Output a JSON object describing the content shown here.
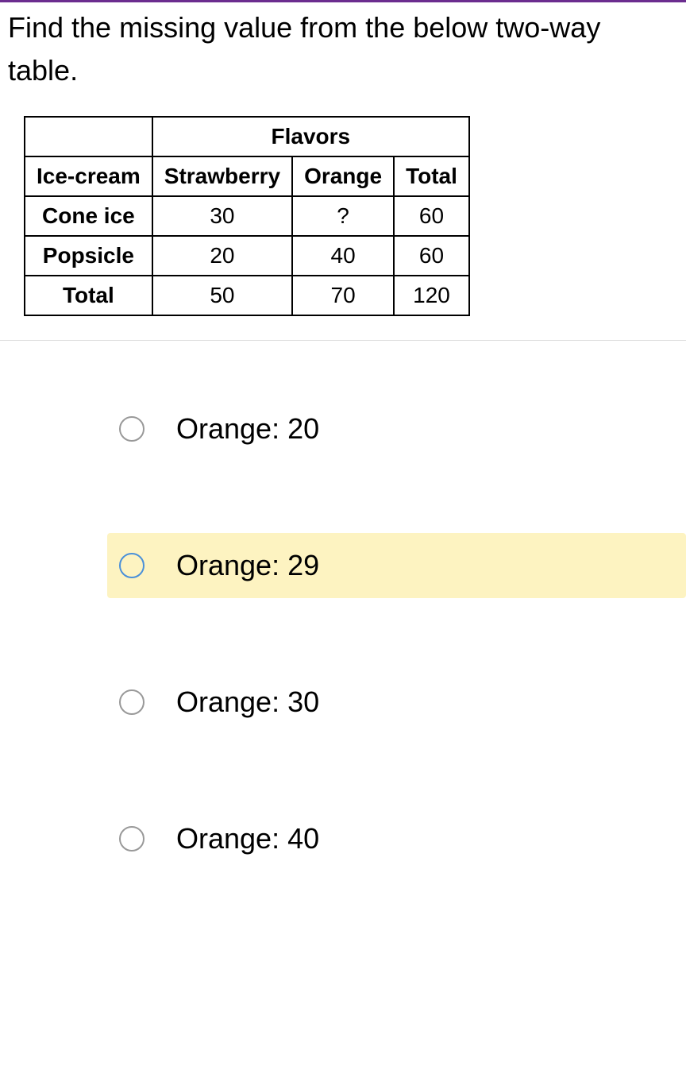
{
  "question": "Find the missing value from the below two-way table.",
  "table": {
    "flavorsHeader": "Flavors",
    "rowHeaders": {
      "iceCream": "Ice-cream",
      "strawberry": "Strawberry",
      "orange": "Orange",
      "total": "Total",
      "coneIce": "Cone ice",
      "popsicle": "Popsicle",
      "totalRow": "Total"
    },
    "cells": {
      "coneStrawberry": "30",
      "coneOrange": "?",
      "coneTotal": "60",
      "popStrawberry": "20",
      "popOrange": "40",
      "popTotal": "60",
      "totStrawberry": "50",
      "totOrange": "70",
      "totTotal": "120"
    }
  },
  "options": [
    {
      "label": "Orange: 20",
      "highlighted": false
    },
    {
      "label": "Orange: 29",
      "highlighted": true
    },
    {
      "label": "Orange: 30",
      "highlighted": false
    },
    {
      "label": "Orange: 40",
      "highlighted": false
    }
  ],
  "chart_data": {
    "type": "table",
    "title": "Flavors two-way table",
    "row_labels": [
      "Cone ice",
      "Popsicle",
      "Total"
    ],
    "col_labels": [
      "Strawberry",
      "Orange",
      "Total"
    ],
    "values": [
      [
        30,
        "?",
        60
      ],
      [
        20,
        40,
        60
      ],
      [
        50,
        70,
        120
      ]
    ]
  }
}
